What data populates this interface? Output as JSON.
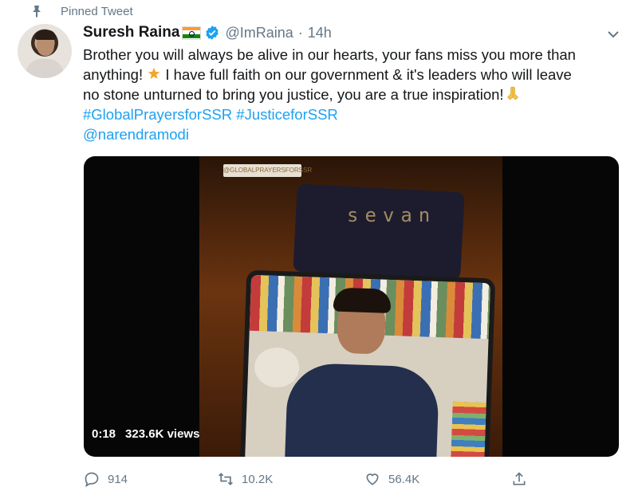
{
  "pinned": {
    "label": "Pinned Tweet",
    "icon": "pin-icon"
  },
  "author": {
    "name": "Suresh Raina",
    "flag": "india-flag-icon",
    "verified": "verified-badge-icon",
    "handle": "@ImRaina",
    "separator": "·",
    "time": "14h"
  },
  "tweet": {
    "line1": "Brother you will always be alive in our hearts, your fans miss you more than",
    "line2_a": "anything! ",
    "line2_b": " I have full faith on our government & it's leaders who will leave",
    "line3": "no stone unturned to bring you justice, you are a true inspiration!",
    "hashtags": [
      "#GlobalPrayersforSSR",
      "#JusticeforSSR"
    ],
    "mention": "@narendramodi"
  },
  "video": {
    "tag_text": "@GLOBALPRAYERSFORSSR",
    "cloth_text": "sevan",
    "duration": "0:18",
    "views": "323.6K views"
  },
  "actions": {
    "reply_count": "914",
    "retweet_count": "10.2K",
    "like_count": "56.4K"
  },
  "colors": {
    "link": "#1da1f2",
    "muted": "#657786",
    "text": "#14171a"
  }
}
